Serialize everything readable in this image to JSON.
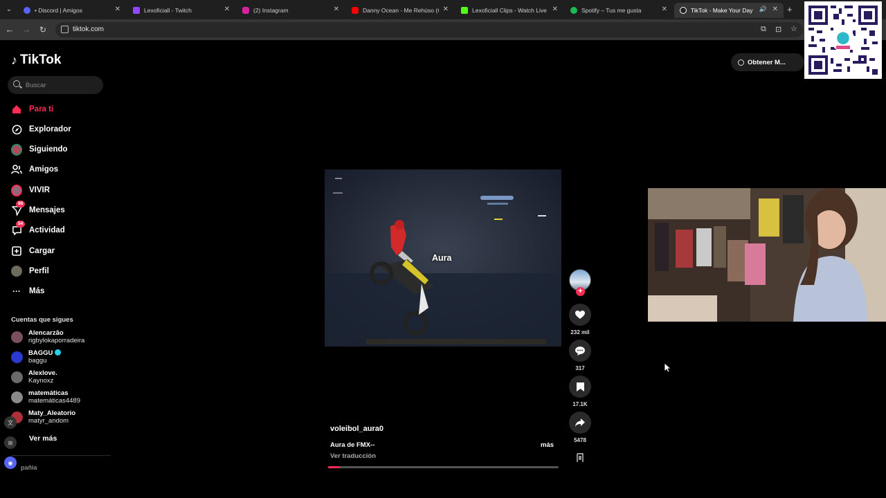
{
  "browser": {
    "tabs": [
      {
        "label": "• Discord | Amigos",
        "icon": "discord-icon",
        "color": "#5865f2"
      },
      {
        "label": "Lexoficiall - Twitch",
        "icon": "twitch-icon",
        "color": "#9146ff"
      },
      {
        "label": "(2) Instagram",
        "icon": "instagram-icon",
        "color": "#d6249f"
      },
      {
        "label": "Danny Ocean - Me Rehúso (Offi",
        "icon": "youtube-icon",
        "color": "#ff0000"
      },
      {
        "label": "Lexoficiall Clips - Watch Live on",
        "icon": "kick-icon",
        "color": "#53fc18"
      },
      {
        "label": "Spotify – Tus me gusta",
        "icon": "spotify-icon",
        "color": "#1db954"
      },
      {
        "label": "TikTok - Make Your Day",
        "icon": "tiktok-icon",
        "color": "#ffffff",
        "active": true
      }
    ],
    "url": "tiktok.com"
  },
  "tiktok": {
    "brand": "TikTok",
    "search_placeholder": "Buscar",
    "nav": [
      {
        "label": "Para ti",
        "icon": "home-icon",
        "active": true
      },
      {
        "label": "Explorador",
        "icon": "compass-icon"
      },
      {
        "label": "Siguiendo",
        "icon": "following-icon"
      },
      {
        "label": "Amigos",
        "icon": "friends-icon"
      },
      {
        "label": "VIVIR",
        "icon": "live-icon"
      },
      {
        "label": "Mensajes",
        "icon": "messages-icon",
        "badge": "98"
      },
      {
        "label": "Actividad",
        "icon": "activity-icon",
        "badge": "54"
      },
      {
        "label": "Cargar",
        "icon": "upload-icon"
      },
      {
        "label": "Perfil",
        "icon": "profile-icon"
      },
      {
        "label": "Más",
        "icon": "more-icon"
      }
    ],
    "following_title": "Cuentas que sigues",
    "following": [
      {
        "name": "Alencarzão",
        "user": "rigbylokaporradeira"
      },
      {
        "name": "BAGGU",
        "user": "baggu",
        "verified": true
      },
      {
        "name": "Alexlove.",
        "user": "Kaynoxz"
      },
      {
        "name": "matemáticas",
        "user": "matemáticas4489"
      },
      {
        "name": "Maty_Aleatorio",
        "user": "matyr_andom"
      }
    ],
    "see_more": "Ver más",
    "footer": "pañia",
    "get_app": "Obtener M...",
    "video": {
      "caption": "Aura",
      "author": "voleibol_aura0",
      "description": "Aura de FMX--",
      "more": "más",
      "translate": "Ver traducción",
      "progress": 0.05
    },
    "actions": {
      "likes": "232 mil",
      "comments": "317",
      "saves": "17.1K",
      "shares": "5478"
    }
  }
}
